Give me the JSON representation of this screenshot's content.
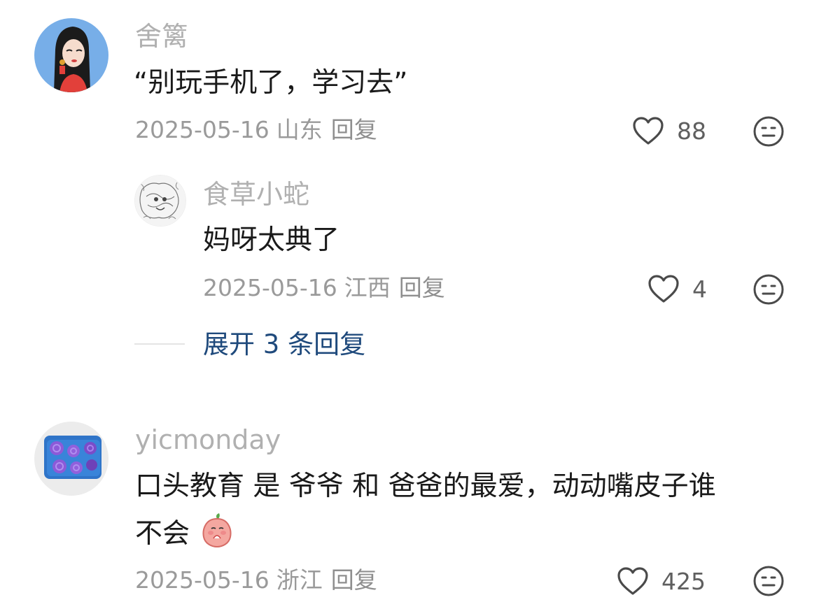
{
  "comments": [
    {
      "username": "舍篱",
      "text": "“别玩手机了，学习去”",
      "date": "2025-05-16",
      "region": "山东",
      "reply_label": "回复",
      "likes": "88",
      "replies": [
        {
          "username": "食草小蛇",
          "text": "妈呀太典了",
          "date": "2025-05-16",
          "region": "江西",
          "reply_label": "回复",
          "likes": "4"
        }
      ],
      "expand_label": "展开 3 条回复"
    },
    {
      "username": "yicmonday",
      "text_line1": "口头教育 是 爷爷 和 爸爸的最爱，动动嘴皮子谁",
      "text_line2": "不会",
      "date": "2025-05-16",
      "region": "浙江",
      "reply_label": "回复",
      "likes": "425"
    }
  ],
  "icons": {
    "like": "heart-outline-icon",
    "dislike": "neutral-face-icon",
    "sticker": "peach-emoji-sticker"
  },
  "colors": {
    "link": "#1f4a7c",
    "username": "#b0b0b0",
    "meta": "#9a9a9a",
    "text": "#1a1a1a"
  }
}
